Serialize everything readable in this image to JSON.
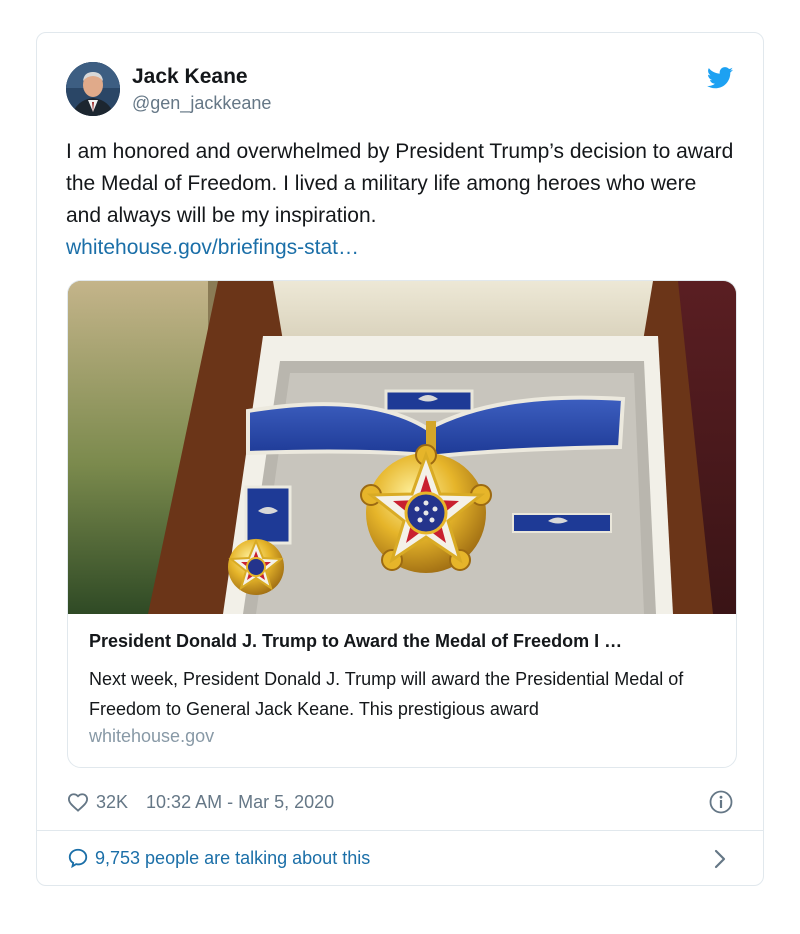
{
  "author": {
    "name": "Jack Keane",
    "handle": "@gen_jackkeane"
  },
  "tweet": {
    "text": "I am honored and overwhelmed by President Trump’s decision to award the Medal of Freedom. I lived a military life among heroes who were and always will be my inspiration.",
    "link_text": "whitehouse.gov/briefings-stat…"
  },
  "link_preview": {
    "title": "President Donald J. Trump to Award the Medal of Freedom I …",
    "description": "Next week, President Donald J. Trump will award the Presidential Medal of Freedom to General Jack Keane.  This prestigious award",
    "domain": "whitehouse.gov"
  },
  "meta": {
    "likes": "32K",
    "timestamp": "10:32 AM - Mar 5, 2020"
  },
  "footer": {
    "talking": "9,753 people are talking about this"
  },
  "colors": {
    "twitter_blue": "#1da1f2",
    "link_blue": "#1b6fa8",
    "muted_gray": "#657786"
  },
  "icons": [
    "twitter-bird-icon",
    "heart-icon",
    "info-icon",
    "comment-bubble-icon",
    "chevron-right-icon"
  ]
}
